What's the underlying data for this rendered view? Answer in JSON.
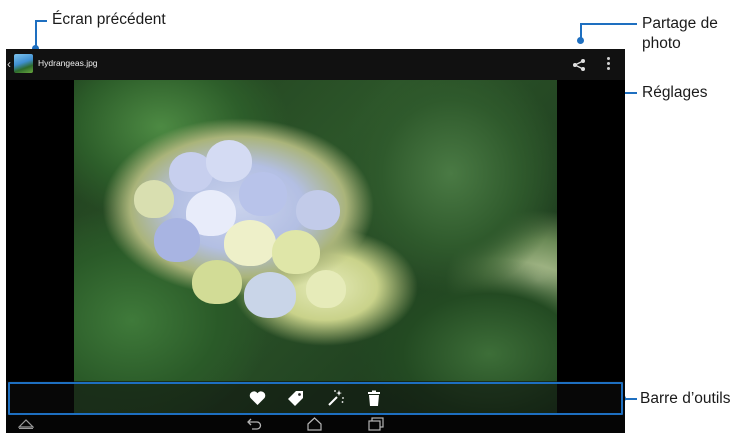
{
  "callouts": {
    "previous_screen": "Écran précédent",
    "photo_share": "Partage de photo",
    "settings": "Réglages",
    "toolbar": "Barre d’outils"
  },
  "topbar": {
    "filename": "Hydrangeas.jpg"
  },
  "icons": {
    "back": "chevron-left-icon",
    "thumbnail": "gallery-icon",
    "share": "share-icon",
    "menu": "overflow-menu-icon",
    "favorite": "heart-icon",
    "tag": "tag-icon",
    "edit": "magic-wand-icon",
    "delete": "trash-icon",
    "home_launcher": "launcher-icon",
    "nav_back": "back-arrow-icon",
    "nav_home": "home-icon",
    "nav_recents": "recent-apps-icon"
  },
  "colors": {
    "callout_line": "#1e6fc0",
    "topbar_bg": "#121212",
    "screen_bg": "#000000"
  }
}
